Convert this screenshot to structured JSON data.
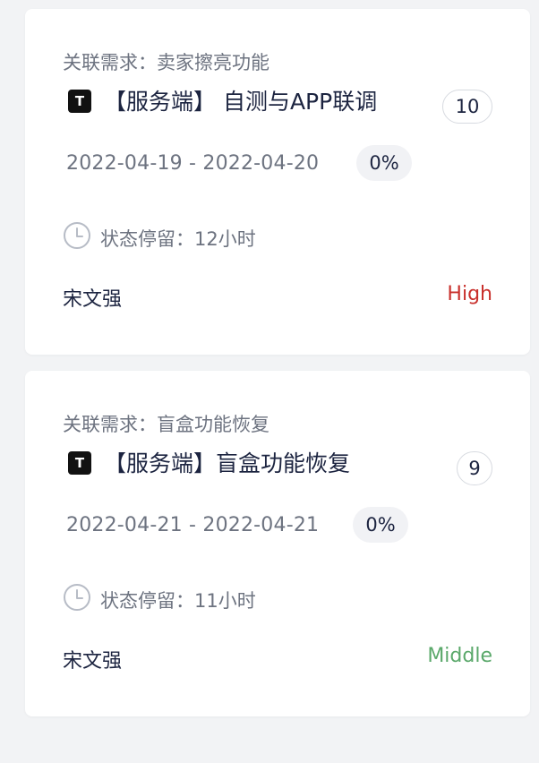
{
  "cards": [
    {
      "requirement": "关联需求：卖家擦亮功能",
      "type_icon_letter": "T",
      "title": "【服务端】 自测与APP联调",
      "count": "10",
      "date_range": "2022-04-19 - 2022-04-20",
      "progress": "0%",
      "stay": "状态停留：12小时",
      "owner": "宋文强",
      "priority": "High",
      "priority_color": "#c9302c"
    },
    {
      "requirement": "关联需求：盲盒功能恢复",
      "type_icon_letter": "T",
      "title": "【服务端】盲盒功能恢复",
      "count": "9",
      "date_range": "2022-04-21 - 2022-04-21",
      "progress": "0%",
      "stay": "状态停留：11小时",
      "owner": "宋文强",
      "priority": "Middle",
      "priority_color": "#5aa86a"
    }
  ],
  "icons": {
    "type": "task-type-icon",
    "clock": "clock-icon"
  }
}
